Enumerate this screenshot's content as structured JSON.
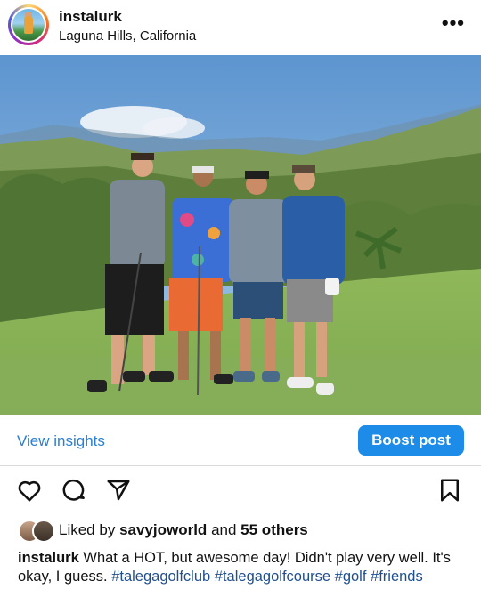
{
  "post": {
    "username": "instalurk",
    "location": "Laguna Hills, California",
    "more_icon": "more-horizontal-icon"
  },
  "insights": {
    "view_label": "View insights",
    "boost_label": "Boost post"
  },
  "actions": {
    "icons": [
      "heart-icon",
      "comment-icon",
      "share-icon",
      "bookmark-icon"
    ]
  },
  "likes": {
    "prefix": "Liked by",
    "user": "savyjoworld",
    "and": "and",
    "others": "55 others"
  },
  "caption": {
    "username": "instalurk",
    "text": "What a HOT, but awesome day! Didn't play very well. It's okay, I guess.",
    "hashtags": [
      "#talegagolfclub",
      "#talegagolfcourse",
      "#golf",
      "#friends"
    ]
  },
  "colors": {
    "link": "#2a7fd4",
    "button": "#1d8be8",
    "hashtag": "#1f4f8f"
  }
}
